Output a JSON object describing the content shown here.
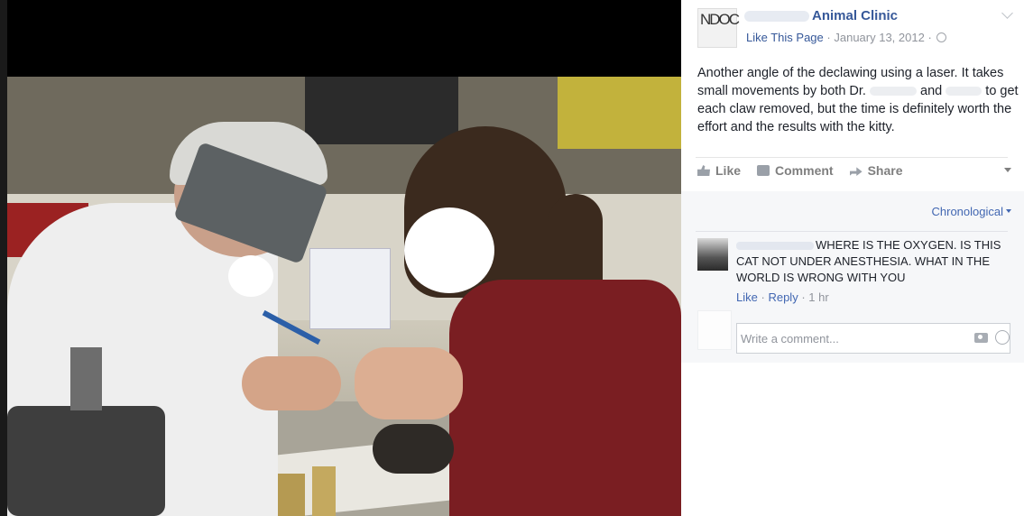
{
  "post": {
    "page_name_visible": "Animal Clinic",
    "like_page": "Like This Page",
    "date": "January 13, 2012",
    "separator": "·",
    "text_part1": "Another angle of the declawing using a laser. It takes small movements by both Dr.",
    "text_and": "and",
    "text_part2": "to get each claw removed, but the time is definitely worth the effort and the results with the kitty.",
    "avatar_glyph": "NDOC"
  },
  "actions": {
    "like": "Like",
    "comment": "Comment",
    "share": "Share"
  },
  "comments": {
    "order_label": "Chronological",
    "items": [
      {
        "text": "WHERE IS THE OXYGEN. IS THIS CAT NOT UNDER ANESTHESIA. WHAT IN THE WORLD IS WRONG WITH YOU",
        "like": "Like",
        "reply": "Reply",
        "time": "1 hr"
      }
    ],
    "write_placeholder": "Write a comment..."
  },
  "icons": {
    "like": "thumbs-up-icon",
    "comment": "speech-bubble-icon",
    "share": "share-arrow-icon",
    "camera": "camera-icon",
    "emoji": "smiley-icon",
    "privacy": "globe-icon"
  },
  "colors": {
    "link": "#365899",
    "muted": "#90949c",
    "comments_bg": "#f6f7f9"
  }
}
